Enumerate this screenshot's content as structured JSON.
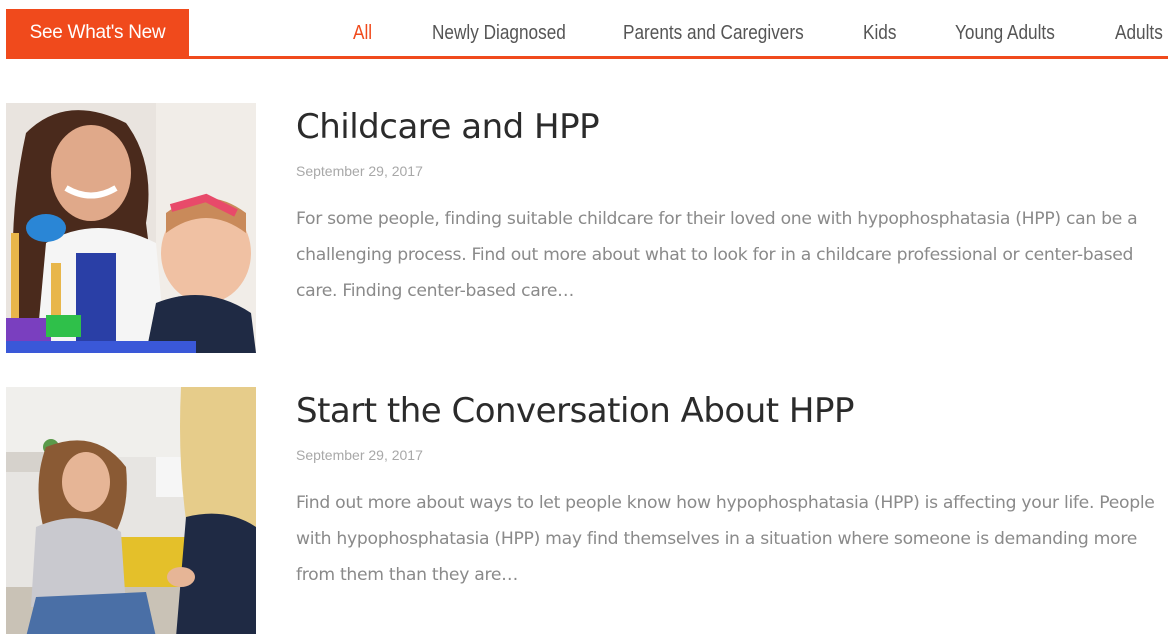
{
  "nav": {
    "whats_new_label": "See What's New",
    "accent_color": "#f04a1c",
    "tabs": [
      {
        "label": "All",
        "active": true
      },
      {
        "label": "Newly Diagnosed",
        "active": false
      },
      {
        "label": "Parents and Caregivers",
        "active": false
      },
      {
        "label": "Kids",
        "active": false
      },
      {
        "label": "Young Adults",
        "active": false
      },
      {
        "label": "Adults",
        "active": false
      }
    ]
  },
  "articles": [
    {
      "title": "Childcare and HPP",
      "date": "September 29, 2017",
      "excerpt": "For some people, finding suitable childcare for their loved one with hypophosphatasia (HPP) can be a challenging process. Find out more about what to look for in a childcare professional or center-based care. Finding center-based care…",
      "thumbnail": "woman-and-baby-with-toy-photo"
    },
    {
      "title": "Start the Conversation About HPP",
      "date": "September 29, 2017",
      "excerpt": "Find out more about ways to let people know how hypophosphatasia (HPP) is affecting your life. People with hypophosphatasia (HPP) may find themselves in a situation where someone is demanding more from them than they are…",
      "thumbnail": "two-young-women-talking-photo"
    }
  ]
}
